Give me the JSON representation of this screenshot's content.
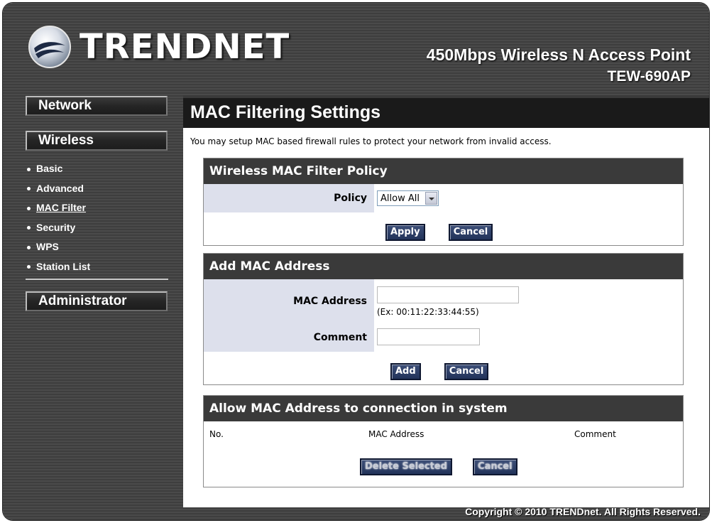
{
  "brand": {
    "logo_text": "TRENDNET",
    "product_title": "450Mbps Wireless N Access Point",
    "product_model": "TEW-690AP"
  },
  "sidebar": {
    "network": "Network",
    "wireless": "Wireless",
    "items": [
      {
        "label": "Basic"
      },
      {
        "label": "Advanced"
      },
      {
        "label": "MAC Filter"
      },
      {
        "label": "Security"
      },
      {
        "label": "WPS"
      },
      {
        "label": "Station List"
      }
    ],
    "administrator": "Administrator"
  },
  "main": {
    "title": "MAC Filtering Settings",
    "intro": "You may setup MAC based firewall rules to protect your network from invalid access."
  },
  "policy_section": {
    "header": "Wireless MAC Filter Policy",
    "policy_label": "Policy",
    "policy_value": "Allow All",
    "apply": "Apply",
    "cancel": "Cancel"
  },
  "add_section": {
    "header": "Add MAC Address",
    "mac_label": "MAC Address",
    "mac_value": "",
    "mac_hint": "(Ex: 00:11:22:33:44:55)",
    "comment_label": "Comment",
    "comment_value": "",
    "add": "Add",
    "cancel": "Cancel"
  },
  "list_section": {
    "header": "Allow MAC Address to connection in system",
    "columns": [
      "No.",
      "MAC Address",
      "Comment"
    ],
    "delete_selected": "Delete Selected",
    "cancel": "Cancel"
  },
  "footer": {
    "copyright": "Copyright © 2010 TRENDnet. All Rights Reserved."
  }
}
